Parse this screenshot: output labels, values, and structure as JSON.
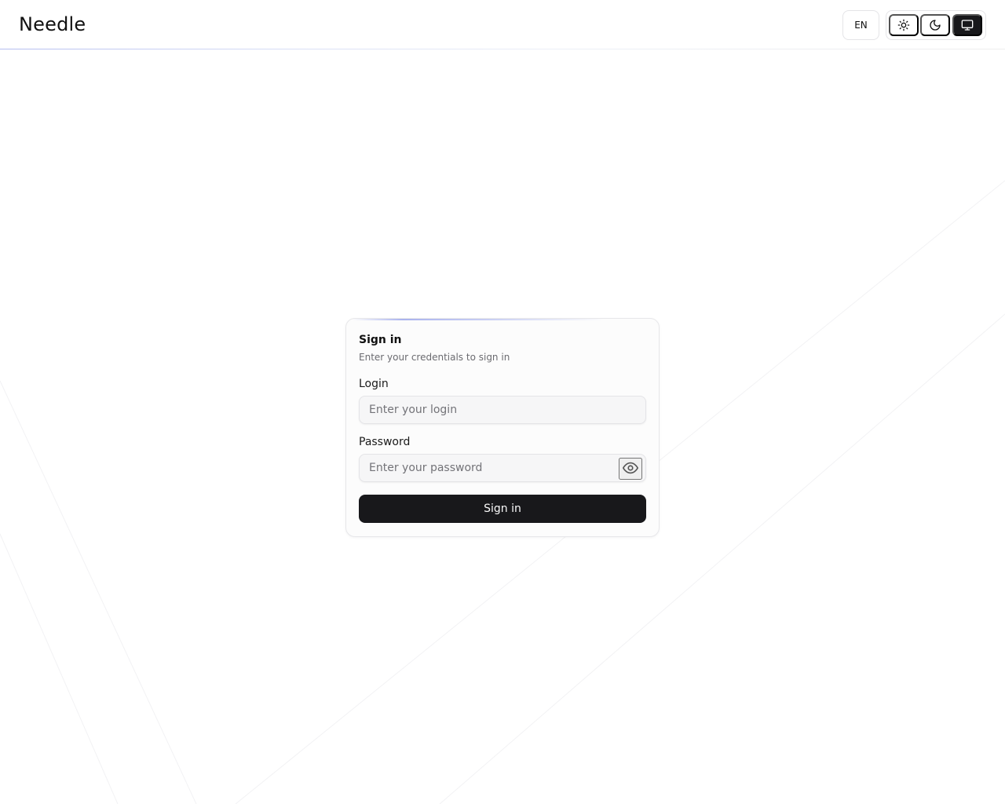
{
  "header": {
    "brand": "Needle",
    "language": "EN",
    "theme_options": [
      "light",
      "dark",
      "system"
    ],
    "theme_selected": "system"
  },
  "icons": {
    "light": "sun-icon",
    "dark": "moon-icon",
    "system": "monitor-icon",
    "password_toggle": "eye-icon"
  },
  "signin": {
    "title": "Sign in",
    "subtitle": "Enter your credentials to sign in",
    "login_label": "Login",
    "login_value": "",
    "login_placeholder": "Enter your login",
    "password_label": "Password",
    "password_value": "",
    "password_placeholder": "Enter your password",
    "submit_label": "Sign in"
  },
  "colors": {
    "primary": "#18181b",
    "primary_text": "#fafafa",
    "accent": "#aab3ee",
    "border": "#e4e4e7",
    "muted_text": "#6b6b70"
  }
}
